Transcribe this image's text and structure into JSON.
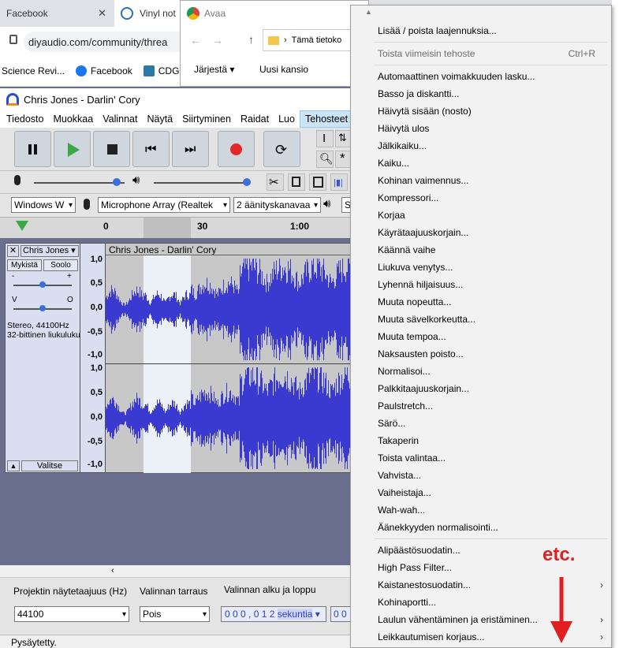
{
  "browser": {
    "tabs": [
      {
        "title": "Facebook"
      },
      {
        "title": "Vinyl not"
      }
    ],
    "address": "diyaudio.com/community/threa",
    "bookmarks": [
      {
        "label": "Science Revi..."
      },
      {
        "label": "Facebook"
      },
      {
        "label": "CDG"
      }
    ]
  },
  "dialog": {
    "title": "Avaa",
    "path": "Tämä tietoko",
    "organize": "Järjestä",
    "new_folder": "Uusi kansio"
  },
  "audacity": {
    "title": "Chris Jones - Darlin' Cory",
    "menu": [
      "Tiedosto",
      "Muokkaa",
      "Valinnat",
      "Näytä",
      "Siirtyminen",
      "Raidat",
      "Luo",
      "Tehosteet"
    ],
    "devices": {
      "host": "Windows W",
      "input": "Microphone Array (Realtek",
      "channels": "2 äänityskanavaa",
      "output": "S"
    },
    "ruler": [
      "0",
      "30",
      "1:00"
    ],
    "track": {
      "name": "Chris Jones",
      "mute": "Mykistä",
      "solo": "Soolo",
      "gain_minus": "-",
      "gain_plus": "+",
      "pan_left": "V",
      "pan_right": "O",
      "info1": "Stereo, 44100Hz",
      "info2": "32-bittinen liukuluku",
      "select": "Valitse",
      "clip_title": "Chris Jones - Darlin' Cory",
      "scale": [
        "1,0",
        "0,5",
        "0,0",
        "-0,5",
        "-1,0",
        "1,0",
        "0,5",
        "0,0",
        "-0,5",
        "-1,0"
      ]
    },
    "bottom": {
      "rate_label": "Projektin näytetaajuus (Hz)",
      "snap_label": "Valinnan tarraus",
      "sel_label": "Valinnan alku ja loppu",
      "rate_value": "44100",
      "snap_value": "Pois",
      "time_value": "0 0 0 , 0 1 2",
      "time_unit": "sekuntia",
      "time_value2": "0 0",
      "status": "Pysäytetty."
    }
  },
  "effects_menu": {
    "manage": "Lisää / poista laajennuksia...",
    "repeat": "Toista viimeisin tehoste",
    "repeat_shortcut": "Ctrl+R",
    "items": [
      "Automaattinen voimakkuuden lasku...",
      "Basso ja diskantti...",
      "Häivytä sisään (nosto)",
      "Häivytä ulos",
      "Jälkikaiku...",
      "Kaiku...",
      "Kohinan vaimennus...",
      "Kompressori...",
      "Korjaa",
      "Käyrätaajuuskorjain...",
      "Käännä vaihe",
      "Liukuva venytys...",
      "Lyhennä hiljaisuus...",
      "Muuta nopeutta...",
      "Muuta sävelkorkeutta...",
      "Muuta tempoa...",
      "Naksausten poisto...",
      "Normalisoi...",
      "Palkkitaajuuskorjain...",
      "Paulstretch...",
      "Särö...",
      "Takaperin",
      "Toista valintaa...",
      "Vahvista...",
      "Vaiheistaja...",
      "Wah-wah...",
      "Äänekkyyden normalisointi..."
    ],
    "items2": [
      {
        "label": "Alipäästösuodatin...",
        "sub": false
      },
      {
        "label": "High Pass Filter...",
        "sub": false
      },
      {
        "label": "Kaistanestosuodatin...",
        "sub": true
      },
      {
        "label": "Kohinaportti...",
        "sub": false
      },
      {
        "label": "Laulun vähentäminen ja eristäminen...",
        "sub": true
      },
      {
        "label": "Leikkautumisen korjaus...",
        "sub": true
      }
    ]
  },
  "annotation": {
    "text": "etc.",
    "color": "#e02020"
  }
}
